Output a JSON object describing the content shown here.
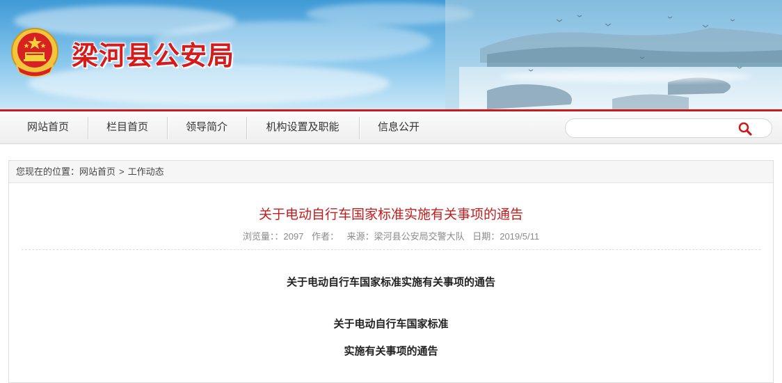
{
  "header": {
    "site_title": "梁河县公安局"
  },
  "nav": {
    "items": [
      {
        "label": "网站首页"
      },
      {
        "label": "栏目首页"
      },
      {
        "label": "领导简介"
      },
      {
        "label": "机构设置及职能"
      },
      {
        "label": "信息公开"
      }
    ],
    "search": {
      "placeholder": ""
    }
  },
  "breadcrumb": {
    "prefix": "您现在的位置：",
    "home": "网站首页",
    "separator": ">",
    "current": "工作动态"
  },
  "article": {
    "title": "关于电动自行车国家标准实施有关事项的通告",
    "meta": {
      "views": "浏览量：：2097",
      "author": "作者：",
      "source": "来源：梁河县公安局交警大队",
      "date": "日期：2019/5/11"
    },
    "body": [
      "关于电动自行车国家标准实施有关事项的通告",
      "关于电动自行车国家标准",
      "实施有关事项的通告"
    ]
  },
  "colors": {
    "accent_red": "#c91b1b",
    "title_red": "#d51b1b"
  }
}
